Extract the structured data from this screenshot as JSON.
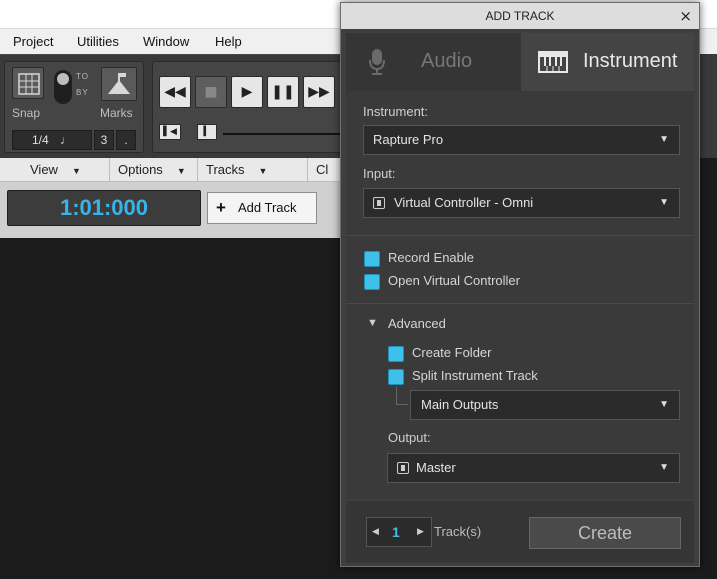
{
  "menubar": {
    "items": [
      "Project",
      "Utilities",
      "Window",
      "Help"
    ]
  },
  "control_bar": {
    "snap_label": "Snap",
    "marks_label": "Marks",
    "toggle_top": "TO",
    "toggle_bottom": "BY",
    "snap_value": "1/4",
    "snap_note": "♩",
    "snap_triplet": "3",
    "snap_dot": "."
  },
  "view_bar": {
    "items": [
      "View",
      "Options",
      "Tracks",
      "Cl"
    ]
  },
  "time_display": "1:01:000",
  "add_track_button": "Add Track",
  "dialog": {
    "title": "ADD TRACK",
    "close": "×",
    "tabs": {
      "audio": "Audio",
      "instrument": "Instrument"
    },
    "instrument_label": "Instrument:",
    "instrument_value": "Rapture Pro",
    "input_label": "Input:",
    "input_value": "Virtual Controller - Omni",
    "record_enable": "Record Enable",
    "open_virtual_controller": "Open Virtual Controller",
    "advanced": "Advanced",
    "create_folder": "Create Folder",
    "split_instrument_track": "Split Instrument Track",
    "split_value": "Main Outputs",
    "output_label": "Output:",
    "output_value": "Master",
    "track_count": "1",
    "tracks_label": "Track(s)",
    "create_button": "Create"
  }
}
